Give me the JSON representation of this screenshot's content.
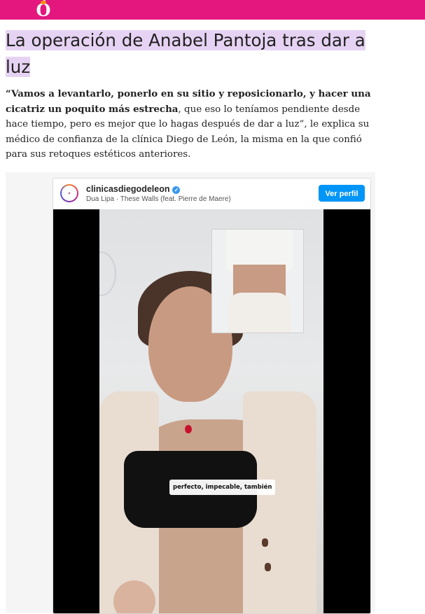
{
  "header": {
    "logo_letter": "Ó",
    "colors": {
      "bar": "#e3177e",
      "logo_dot": "#f39200"
    }
  },
  "article": {
    "title": "La operación de Anabel Pantoja tras dar a luz",
    "title_highlight_color": "#e6d3f3",
    "quote_bold_1": "“Vamos a levantarlo, ponerlo en su sitio y reposicionarlo, y hacer una cicatriz un poquito más estrecha",
    "quote_rest": ", que eso lo teníamos pendiente desde hace tiempo, pero es mejor que lo hagas después de dar a luz”",
    "quote_tail": ", le explica su médico de confianza de la clínica Diego de León, la misma en la que confió para sus retoques estéticos anteriores."
  },
  "instagram_embed": {
    "avatar_icon": "clinic-logo-icon",
    "username": "clinicasdiegodeleon",
    "verified_icon": "verified-badge-icon",
    "song": "Dua Lipa · These Walls (feat. Pierre de Maere)",
    "view_profile_button": "Ver perfil",
    "video_caption": "perfecto, impecable, también",
    "colors": {
      "button": "#0095f6",
      "verified": "#3897f0"
    }
  }
}
